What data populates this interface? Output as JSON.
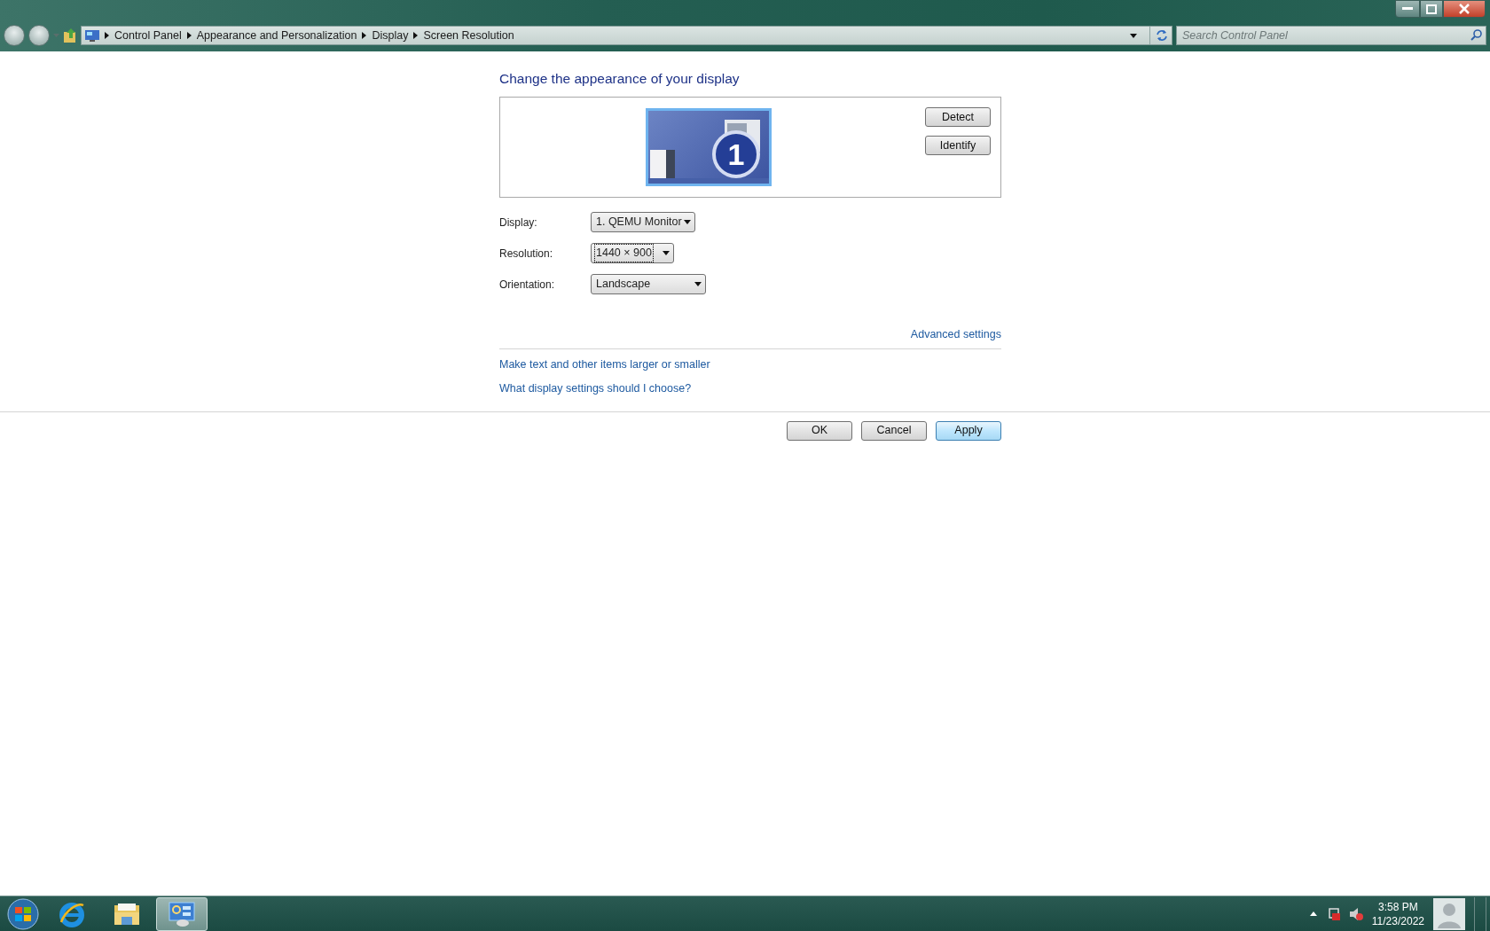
{
  "address_bar": {
    "breadcrumb": [
      "Control Panel",
      "Appearance and Personalization",
      "Display",
      "Screen Resolution"
    ],
    "search": {
      "placeholder": "Search Control Panel"
    }
  },
  "page": {
    "heading": "Change the appearance of your display",
    "monitor_number": "1",
    "side_buttons": [
      "Detect",
      "Identify"
    ],
    "fields": [
      {
        "label": "Display:",
        "value": "1. QEMU Monitor",
        "focused": false
      },
      {
        "label": "Resolution:",
        "value": "1440 × 900",
        "focused": true
      },
      {
        "label": "Orientation:",
        "value": "Landscape",
        "focused": false
      }
    ],
    "advanced_link": "Advanced settings",
    "links": [
      "Make text and other items larger or smaller",
      "What display settings should I choose?"
    ],
    "buttons": [
      {
        "label": "OK",
        "hover": false
      },
      {
        "label": "Cancel",
        "hover": false
      },
      {
        "label": "Apply",
        "hover": true
      }
    ]
  },
  "taskbar": {
    "apps": [
      {
        "kind": "browser",
        "selected": false
      },
      {
        "kind": "folder",
        "selected": false
      },
      {
        "kind": "control-panel",
        "selected": true
      }
    ],
    "clock": {
      "time": "3:58 PM",
      "date": "11/23/2022"
    }
  }
}
